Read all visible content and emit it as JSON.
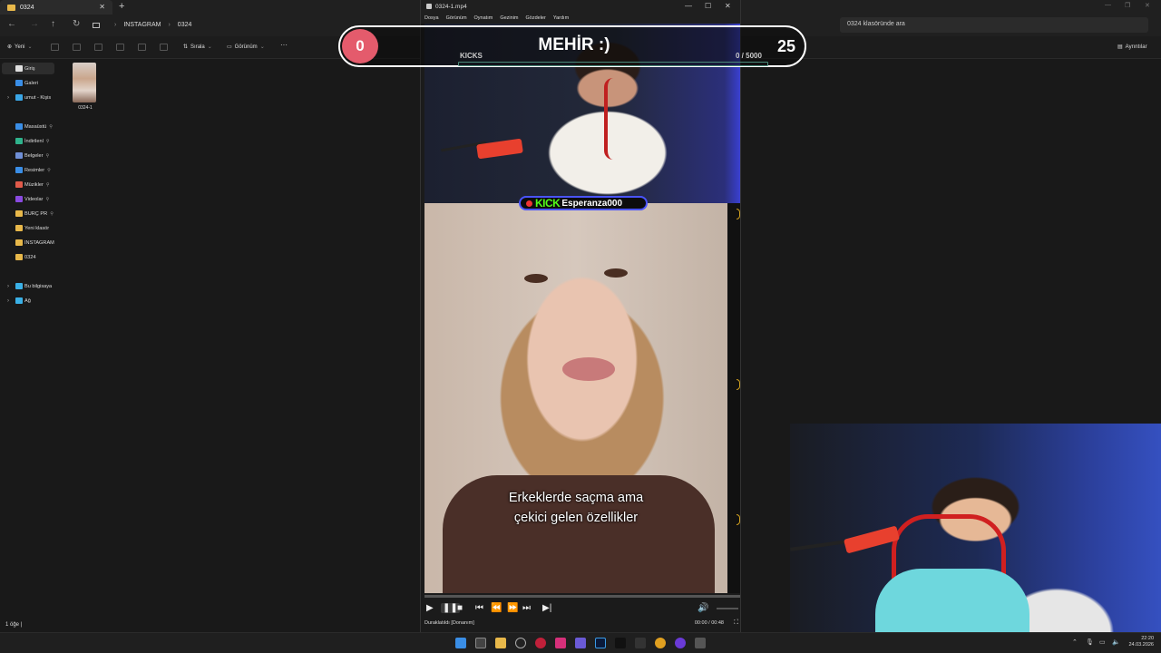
{
  "explorer": {
    "tab_title": "0324",
    "breadcrumb": [
      "INSTAGRAM",
      "0324"
    ],
    "search_placeholder": "0324 klasöründe ara",
    "toolbar": {
      "new_label": "Yeni",
      "sort_label": "Sırala",
      "view_label": "Görünüm",
      "more_label": "···",
      "details_label": "Ayrıntılar"
    },
    "sidebar": [
      {
        "label": "Giriş",
        "icon": "home-icon",
        "color": "#e0e0e0",
        "selected": true
      },
      {
        "label": "Galeri",
        "icon": "gallery-icon",
        "color": "#3a8ee6"
      },
      {
        "label": "umut - Kişis",
        "icon": "cloud-icon",
        "color": "#3aa6e6",
        "expand": true
      },
      {
        "label": "Masaüstü",
        "icon": "desktop-icon",
        "color": "#3a8ee6",
        "pinned": true
      },
      {
        "label": "İndirilenl",
        "icon": "download-icon",
        "color": "#2fb38c",
        "pinned": true
      },
      {
        "label": "Belgeler",
        "icon": "document-icon",
        "color": "#6f8fd6",
        "pinned": true
      },
      {
        "label": "Resimler",
        "icon": "pictures-icon",
        "color": "#3a8ee6",
        "pinned": true
      },
      {
        "label": "Müzikler",
        "icon": "music-icon",
        "color": "#e05a4a",
        "pinned": true
      },
      {
        "label": "Videolar",
        "icon": "video-icon",
        "color": "#8a4ae0",
        "pinned": true
      },
      {
        "label": "BURÇ PR",
        "icon": "folder-icon",
        "color": "#e8b84a",
        "pinned": true
      },
      {
        "label": "Yeni klasör",
        "icon": "folder-icon",
        "color": "#e8b84a"
      },
      {
        "label": "INSTAGRAM",
        "icon": "folder-icon",
        "color": "#e8b84a"
      },
      {
        "label": "0324",
        "icon": "folder-icon",
        "color": "#e8b84a"
      },
      {
        "label": "Bu bilgisaya",
        "icon": "computer-icon",
        "color": "#3ab0e6",
        "expand": true
      },
      {
        "label": "Ağ",
        "icon": "network-icon",
        "color": "#3ab0e6",
        "expand": true
      }
    ],
    "file": {
      "name": "0324-1"
    },
    "status": "1 öğe  |"
  },
  "player": {
    "title": "0324-1.mp4",
    "menu": [
      "Dosya",
      "Görünüm",
      "Oynatım",
      "Gezinim",
      "Gözdeler",
      "Yardım"
    ],
    "caption_line1": "Erkeklerde saçma ama",
    "caption_line2": "çekici gelen özellikler",
    "badge_kick": "KICK",
    "badge_name": "Esperanza000",
    "status_text": "Duraklatıldı [Donanım]",
    "time": "00:00 / 00:48",
    "progress": 0
  },
  "goal": {
    "left_count": "0",
    "title": "MEHİR :)",
    "right_count": "25",
    "label": "KICKS",
    "progress_text": "0  / 5000"
  },
  "taskbar": {
    "time": "22:20",
    "date": "24.03.2026"
  }
}
